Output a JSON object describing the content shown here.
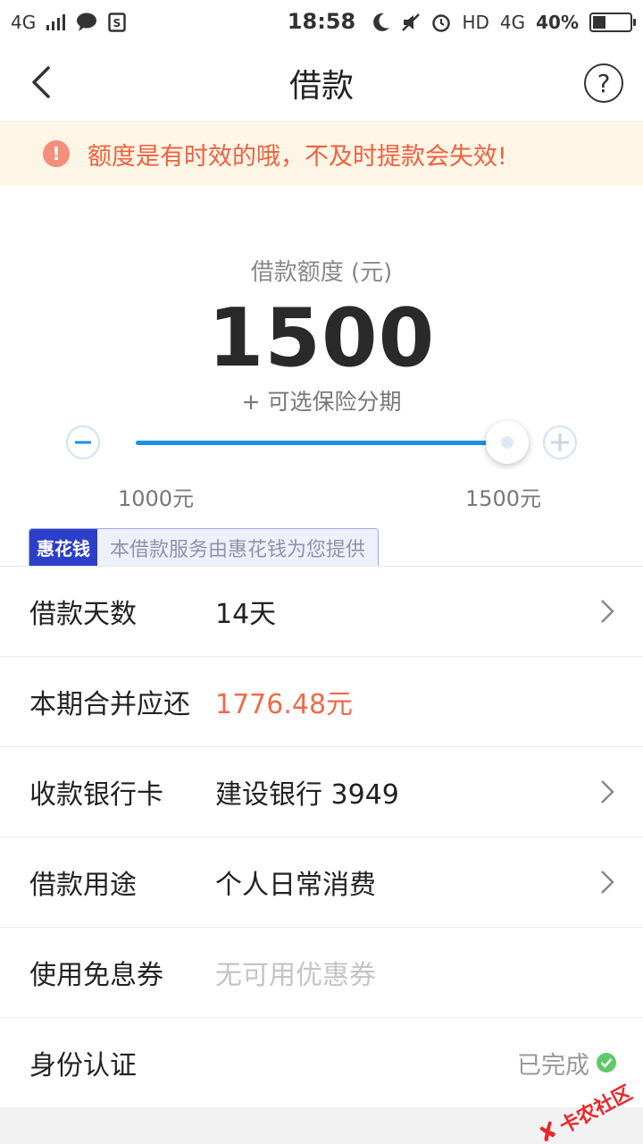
{
  "status_bar": {
    "network": "4G",
    "time": "18:58",
    "hd": "HD",
    "network_right": "4G",
    "battery": "40%",
    "battery_level": 0.4
  },
  "nav": {
    "title": "借款",
    "help_label": "?"
  },
  "notice": {
    "icon": "!",
    "text": "额度是有时效的哦，不及时提款会失效!"
  },
  "loan": {
    "amount_label": "借款额度 (元)",
    "amount": "1500",
    "insurance_option": "+ 可选保险分期",
    "min": 1000,
    "max": 1500,
    "current": 1500,
    "min_label": "1000元",
    "max_label": "1500元"
  },
  "provider": {
    "tag": "惠花钱",
    "text": "本借款服务由惠花钱为您提供"
  },
  "rows": [
    {
      "label": "借款天数",
      "value": "14天"
    },
    {
      "label": "本期合并应还",
      "value": "1776.48元"
    },
    {
      "label": "收款银行卡",
      "value": "建设银行 3949"
    },
    {
      "label": "借款用途",
      "value": "个人日常消费"
    },
    {
      "label": "使用免息券",
      "value": "无可用优惠券"
    },
    {
      "label": "身份认证",
      "value": "已完成"
    }
  ],
  "watermark": "卡农社区",
  "colors": {
    "accent_blue": "#1a90e6",
    "warning_text": "#f0603e",
    "warning_bg": "#fdf6e6",
    "highlight_amount": "#ef6a49",
    "success": "#5ec96a"
  }
}
